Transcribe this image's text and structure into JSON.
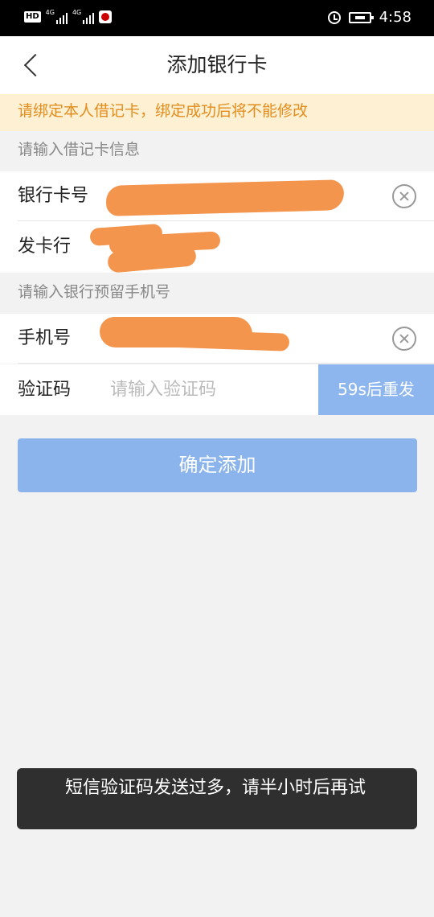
{
  "status_bar": {
    "network_label": "HD",
    "signal_1": "4G",
    "signal_2": "4G",
    "time": "4:58"
  },
  "nav": {
    "title": "添加银行卡"
  },
  "notice": {
    "text": "请绑定本人借记卡，绑定成功后将不能修改"
  },
  "sections": {
    "card_info_title": "请输入借记卡信息",
    "phone_info_title": "请输入银行预留手机号"
  },
  "form": {
    "card_number_label": "银行卡号",
    "issuer_label": "发卡行",
    "phone_label": "手机号",
    "code_label": "验证码",
    "code_placeholder": "请输入验证码",
    "resend_label": "59s后重发"
  },
  "confirm_button": {
    "label": "确定添加"
  },
  "toast": {
    "text": "短信验证码发送过多，请半小时后再试"
  },
  "colors": {
    "accent_blue": "#8bb3ec",
    "notice_text": "#e38d1d",
    "notice_bg": "#fdf0d3",
    "redaction": "#f4954e"
  }
}
